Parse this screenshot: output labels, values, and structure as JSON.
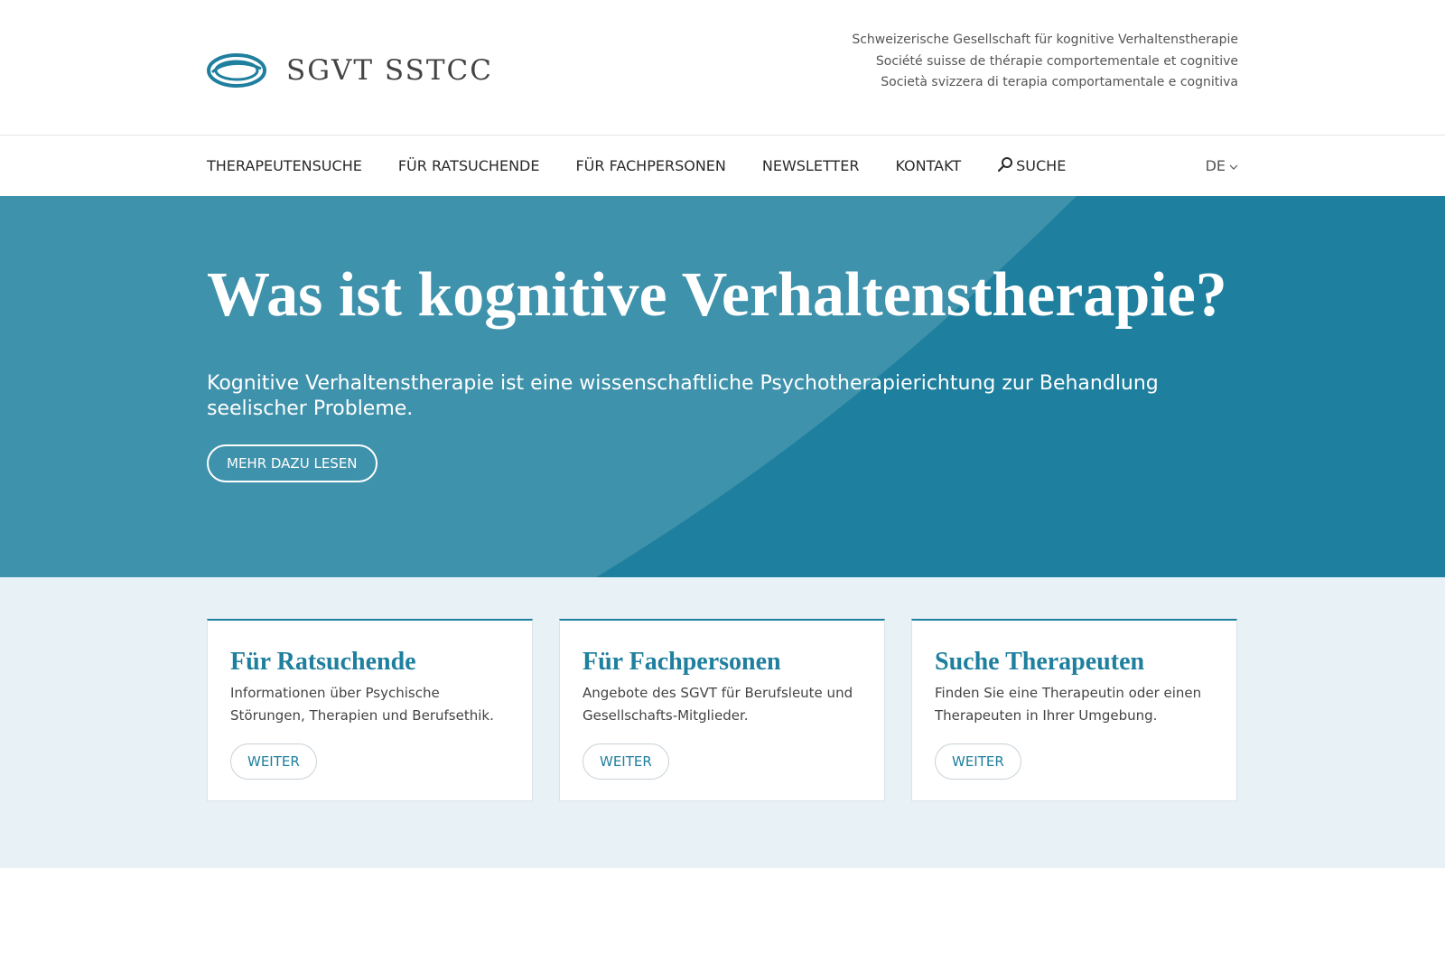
{
  "header": {
    "logo_text": "SGVT SSTCC",
    "tagline": [
      "Schweizerische Gesellschaft für kognitive Verhaltenstherapie",
      "Société suisse de thérapie comportementale et cognitive",
      "Società svizzera di terapia comportamentale e cognitiva"
    ]
  },
  "nav": {
    "items": [
      {
        "label": "THERAPEUTENSUCHE"
      },
      {
        "label": "FÜR RATSUCHENDE"
      },
      {
        "label": "FÜR FACHPERSONEN"
      },
      {
        "label": "NEWSLETTER"
      },
      {
        "label": "KONTAKT"
      },
      {
        "label": "SUCHE",
        "icon": "search-icon"
      }
    ],
    "language": "DE",
    "language_icon": "chevron-down-icon"
  },
  "hero": {
    "title": "Was ist kognitive Verhaltenstherapie?",
    "text": "Kognitive Verhaltenstherapie ist eine wissenschaftliche Psychotherapierichtung zur Behandlung seelischer Probleme.",
    "button_label": "MEHR DAZU LESEN"
  },
  "cards": [
    {
      "title": "Für Ratsuchende",
      "text": "Informationen über Psychische Störungen, Therapien und Berufsethik.",
      "button_label": "WEITER"
    },
    {
      "title": "Für Fachpersonen",
      "text": "Angebote des SGVT für Berufsleute und Gesellschafts-Mitglieder.",
      "button_label": "WEITER"
    },
    {
      "title": "Suche Therapeuten",
      "text": "Finden Sie eine Therapeutin oder einen Therapeuten in Ihrer Umgebung.",
      "button_label": "WEITER"
    }
  ],
  "colors": {
    "accent": "#1e7f9e",
    "hero_light": "#3f92ab",
    "cards_bg": "#e8f1f6"
  }
}
